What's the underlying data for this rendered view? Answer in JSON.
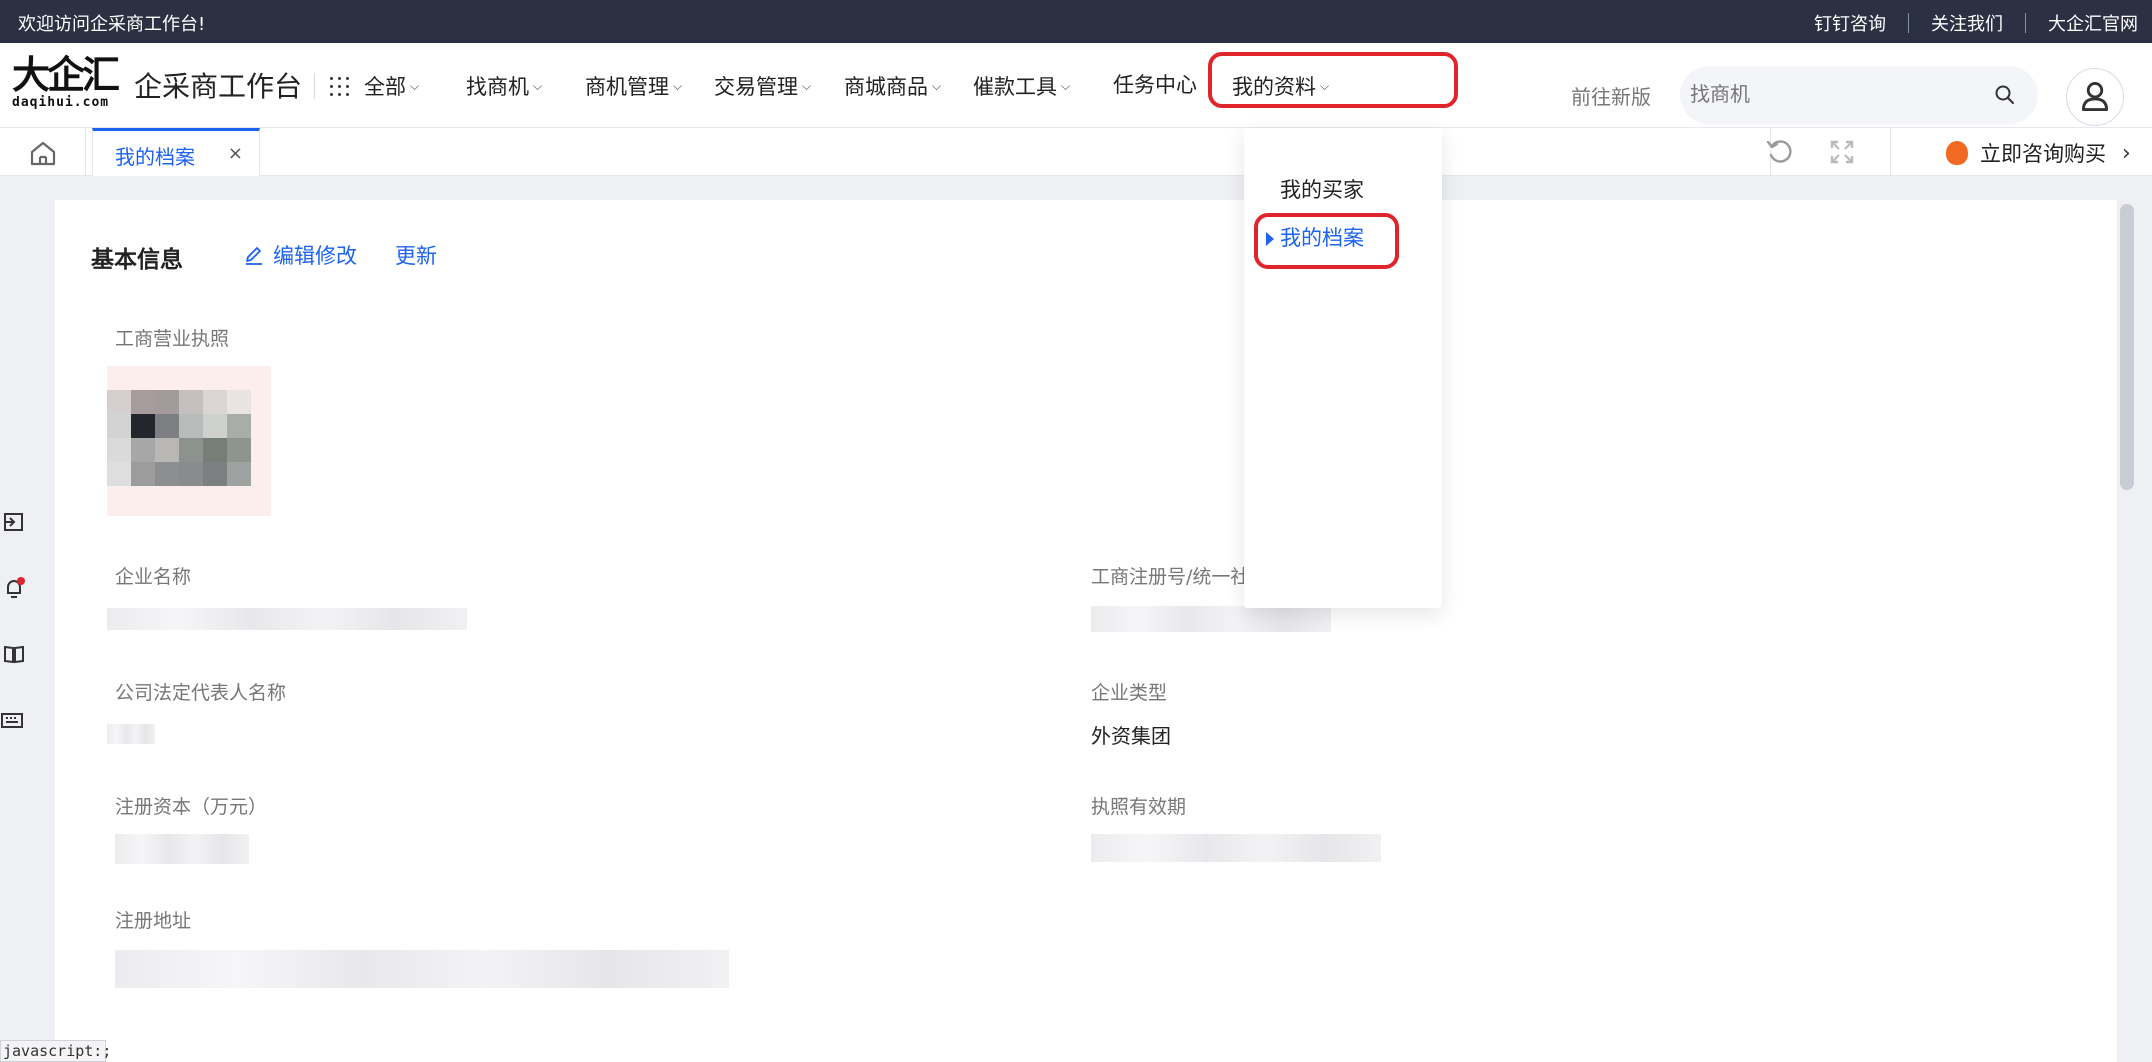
{
  "topbar": {
    "welcome": "欢迎访问企采商工作台!",
    "links": [
      "钉钉咨询",
      "关注我们",
      "大企汇官网"
    ]
  },
  "header": {
    "logo_mark": "大企汇",
    "logo_sub": "daqihui.com",
    "site_title": "企采商工作台",
    "nav": {
      "all": "全部",
      "find": "找商机",
      "manage": "商机管理",
      "trade": "交易管理",
      "mall": "商城商品",
      "collect": "催款工具",
      "tasks": "任务中心",
      "mydata": "我的资料"
    },
    "new_version": "前往新版",
    "search_placeholder": "找商机"
  },
  "dropdown": {
    "items": [
      "我的买家",
      "我的档案"
    ],
    "active_index": 1
  },
  "tabs": {
    "active_label": "我的档案",
    "close": "×"
  },
  "toolbar": {
    "consult": "立即咨询购买"
  },
  "basic_info": {
    "title": "基本信息",
    "edit": "编辑修改",
    "update": "更新",
    "fields": {
      "license": "工商营业执照",
      "company_name": "企业名称",
      "reg_no": "工商注册号/统一社",
      "legal_rep": "公司法定代表人名称",
      "company_type": "企业类型",
      "company_type_value": "外资集团",
      "reg_capital": "注册资本（万元）",
      "license_validity": "执照有效期",
      "reg_address": "注册地址"
    }
  },
  "status_tip": "javascript:;",
  "colors": {
    "accent": "#1d63f0",
    "highlight": "#e0242b",
    "topbar": "#2b3142"
  }
}
